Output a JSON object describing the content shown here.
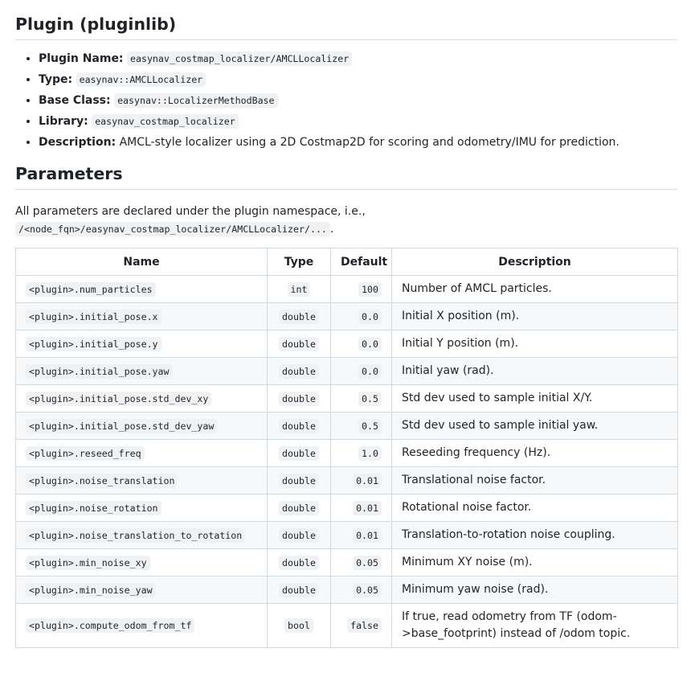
{
  "plugin_section": {
    "heading": "Plugin (pluginlib)",
    "items": [
      {
        "key": "Plugin Name:",
        "value": "easynav_costmap_localizer/AMCLLocalizer",
        "code": true
      },
      {
        "key": "Type:",
        "value": "easynav::AMCLLocalizer",
        "code": true
      },
      {
        "key": "Base Class:",
        "value": "easynav::LocalizerMethodBase",
        "code": true
      },
      {
        "key": "Library:",
        "value": "easynav_costmap_localizer",
        "code": true
      },
      {
        "key": "Description:",
        "value": "AMCL-style localizer using a 2D Costmap2D for scoring and odometry/IMU for prediction.",
        "code": false
      }
    ]
  },
  "parameters_section": {
    "heading": "Parameters",
    "intro_text": "All parameters are declared under the plugin namespace, i.e.,",
    "intro_code": "/<node_fqn>/easynav_costmap_localizer/AMCLLocalizer/...",
    "intro_end": ".",
    "table": {
      "headers": [
        "Name",
        "Type",
        "Default",
        "Description"
      ],
      "rows": [
        {
          "name": "<plugin>.num_particles",
          "type": "int",
          "default": "100",
          "description": "Number of AMCL particles."
        },
        {
          "name": "<plugin>.initial_pose.x",
          "type": "double",
          "default": "0.0",
          "description": "Initial X position (m)."
        },
        {
          "name": "<plugin>.initial_pose.y",
          "type": "double",
          "default": "0.0",
          "description": "Initial Y position (m)."
        },
        {
          "name": "<plugin>.initial_pose.yaw",
          "type": "double",
          "default": "0.0",
          "description": "Initial yaw (rad)."
        },
        {
          "name": "<plugin>.initial_pose.std_dev_xy",
          "type": "double",
          "default": "0.5",
          "description": "Std dev used to sample initial X/Y."
        },
        {
          "name": "<plugin>.initial_pose.std_dev_yaw",
          "type": "double",
          "default": "0.5",
          "description": "Std dev used to sample initial yaw."
        },
        {
          "name": "<plugin>.reseed_freq",
          "type": "double",
          "default": "1.0",
          "description": "Reseeding frequency (Hz)."
        },
        {
          "name": "<plugin>.noise_translation",
          "type": "double",
          "default": "0.01",
          "description": "Translational noise factor."
        },
        {
          "name": "<plugin>.noise_rotation",
          "type": "double",
          "default": "0.01",
          "description": "Rotational noise factor."
        },
        {
          "name": "<plugin>.noise_translation_to_rotation",
          "type": "double",
          "default": "0.01",
          "description": "Translation-to-rotation noise coupling."
        },
        {
          "name": "<plugin>.min_noise_xy",
          "type": "double",
          "default": "0.05",
          "description": "Minimum XY noise (m)."
        },
        {
          "name": "<plugin>.min_noise_yaw",
          "type": "double",
          "default": "0.05",
          "description": "Minimum yaw noise (rad)."
        },
        {
          "name": "<plugin>.compute_odom_from_tf",
          "type": "bool",
          "default": "false",
          "description": "If true, read odometry from TF (odom->base_footprint) instead of /odom topic."
        }
      ]
    }
  }
}
